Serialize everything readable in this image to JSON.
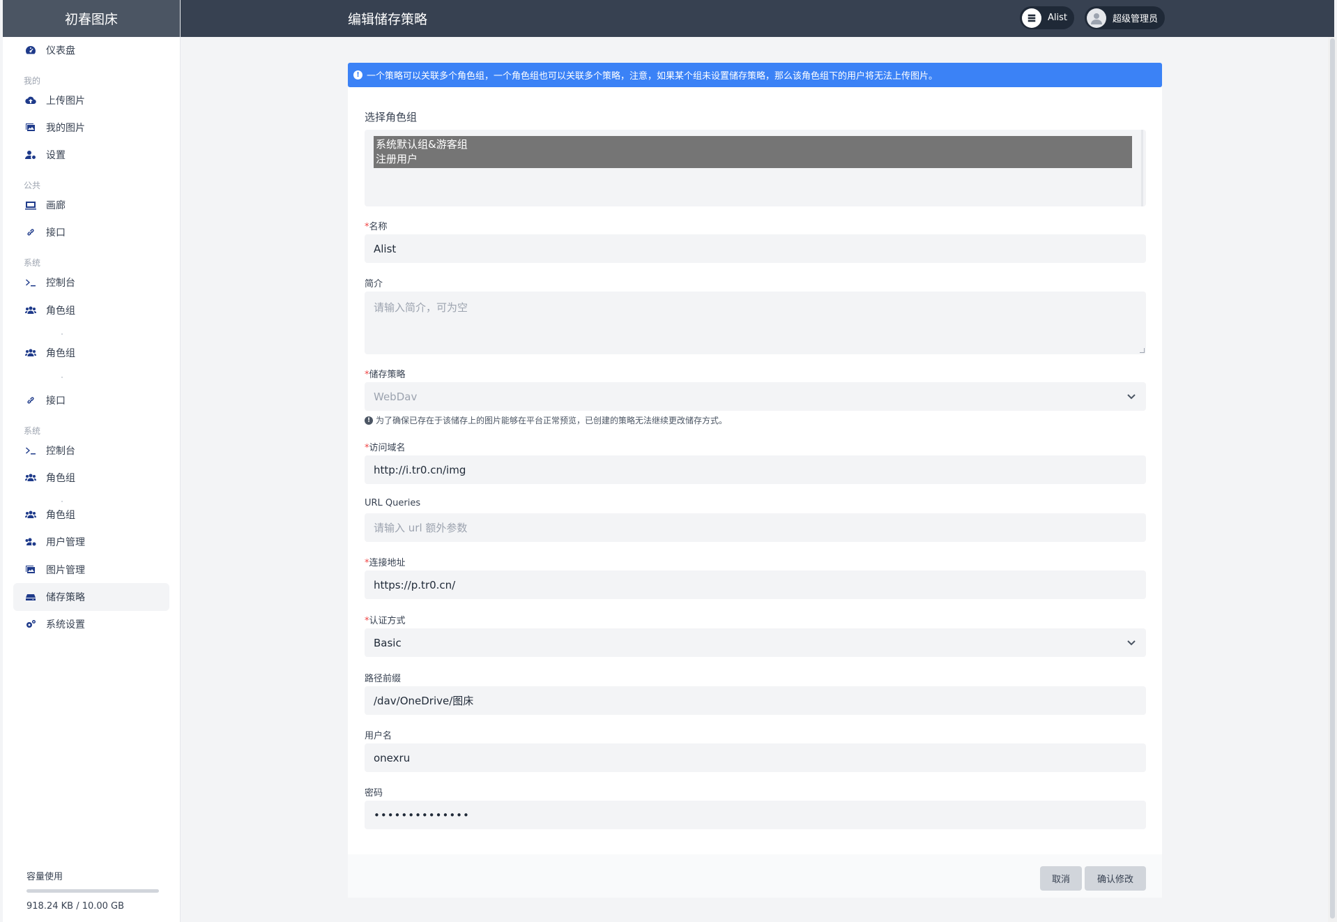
{
  "app": {
    "brand": "初春图床",
    "page_title": "编辑储存策略"
  },
  "header": {
    "storage_pill": "Alist",
    "user_pill": "超级管理员"
  },
  "sidebar": {
    "items": [
      {
        "label": "仪表盘",
        "icon": "dashboard-icon"
      },
      {
        "group": "我的"
      },
      {
        "label": "上传图片",
        "icon": "cloud-upload-icon"
      },
      {
        "label": "我的图片",
        "icon": "images-icon"
      },
      {
        "label": "设置",
        "icon": "user-cog-icon"
      },
      {
        "group": "公共"
      },
      {
        "label": "画廊",
        "icon": "gallery-icon"
      },
      {
        "label": "接口",
        "icon": "link-icon"
      },
      {
        "group": "系统"
      },
      {
        "label": "控制台",
        "icon": "terminal-icon"
      },
      {
        "label": "角色组",
        "icon": "users-icon"
      },
      {
        "label": "角色组",
        "icon": "users-icon"
      },
      {
        "label": "接口",
        "icon": "link-icon"
      },
      {
        "group": "系统"
      },
      {
        "label": "控制台",
        "icon": "terminal-icon"
      },
      {
        "label": "角色组",
        "icon": "users-icon"
      },
      {
        "label": "角色组",
        "icon": "users-icon"
      },
      {
        "label": "用户管理",
        "icon": "users-cog-icon"
      },
      {
        "label": "图片管理",
        "icon": "images-icon"
      },
      {
        "label": "储存策略",
        "icon": "storage-icon",
        "active": true
      },
      {
        "label": "系统设置",
        "icon": "cogs-icon"
      }
    ],
    "usage": {
      "title": "容量使用",
      "text": "918.24 KB / 10.00 GB",
      "fraction": 0.0001
    }
  },
  "alert": {
    "text": "一个策略可以关联多个角色组，一个角色组也可以关联多个策略，注意，如果某个组未设置储存策略，那么该角色组下的用户将无法上传图片。"
  },
  "form": {
    "roles": {
      "label": "选择角色组",
      "options": [
        "系统默认组&游客组",
        "注册用户"
      ]
    },
    "name": {
      "label": "名称",
      "value": "Alist"
    },
    "intro": {
      "label": "简介",
      "placeholder": "请输入简介，可为空"
    },
    "strategy": {
      "label": "储存策略",
      "value": "WebDav",
      "hint": "为了确保已存在于该储存上的图片能够在平台正常预览，已创建的策略无法继续更改储存方式。"
    },
    "domain": {
      "label": "访问域名",
      "value": "http://i.tr0.cn/img"
    },
    "queries": {
      "label": "URL Queries",
      "placeholder": "请输入 url 额外参数"
    },
    "endpoint": {
      "label": "连接地址",
      "value": "https://p.tr0.cn/"
    },
    "auth": {
      "label": "认证方式",
      "value": "Basic"
    },
    "prefix": {
      "label": "路径前缀",
      "value": "/dav/OneDrive/图床"
    },
    "username": {
      "label": "用户名",
      "value": "onexru"
    },
    "password": {
      "label": "密码",
      "value": "••••••••••••••"
    },
    "required_mark": "*"
  },
  "buttons": {
    "cancel": "取消",
    "confirm": "确认修改"
  },
  "colors": {
    "alert_bg": "#3b82f6",
    "header_bg": "#374151",
    "brand_bg": "#4b5563",
    "required": "#ef4444",
    "icon": "#1e3a8a"
  }
}
